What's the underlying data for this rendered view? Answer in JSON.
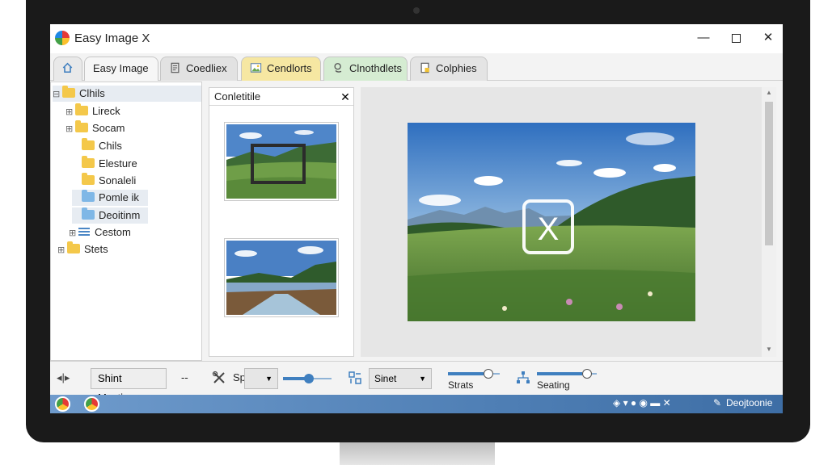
{
  "window": {
    "title": "Easy Image X",
    "minimize": "—",
    "close": "✕"
  },
  "tabs": [
    {
      "label": "",
      "icon": "home-icon"
    },
    {
      "label": "Easy Image"
    },
    {
      "label": "Coedliex",
      "icon": "document-icon"
    },
    {
      "label": "Cendlorts",
      "icon": "image-icon"
    },
    {
      "label": "Clnothdlets",
      "icon": "search-icon"
    },
    {
      "label": "Colphies",
      "icon": "page-icon"
    }
  ],
  "tree": {
    "items": [
      {
        "label": "Clhils",
        "expander": "⊟",
        "icon": "folder-icon"
      },
      {
        "label": "Lireck",
        "expander": "⊞",
        "icon": "folder-icon"
      },
      {
        "label": "Socam",
        "expander": "⊞",
        "icon": "folder-icon"
      },
      {
        "label": "Chils",
        "expander": "",
        "icon": "folder-icon"
      },
      {
        "label": "Elesture",
        "expander": "",
        "icon": "folder-icon"
      },
      {
        "label": "Sonaleli",
        "expander": "",
        "icon": "folder-icon"
      },
      {
        "label": "Pomle ik",
        "expander": "",
        "icon": "folder-blue-icon",
        "selected": true
      },
      {
        "label": "Deoitinm",
        "expander": "",
        "icon": "folder-blue-icon",
        "selected": true
      },
      {
        "label": "Cestom",
        "expander": "⊞",
        "icon": "list-icon"
      },
      {
        "label": "Stets",
        "expander": "⊞",
        "icon": "folder-icon"
      }
    ]
  },
  "thumbnails": {
    "title": "Conletitile",
    "close": "✕"
  },
  "preview": {
    "overlay_glyph": "X"
  },
  "toolbar": {
    "nav_left": "◂|▸",
    "manage_button": "Shint Masting",
    "dash": "--",
    "spot_label": "Spst",
    "mode_select": "Sinet",
    "strats_label": "Strats",
    "seating_label": "Seating"
  },
  "taskbar": {
    "tray_text": "Deojtoonie"
  },
  "colors": {
    "accent": "#3f7fbf",
    "taskbar": "#4f7fb5"
  }
}
